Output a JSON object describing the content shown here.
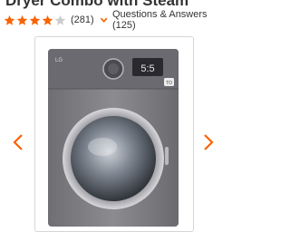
{
  "product": {
    "title": "Dryer Combo with Steam",
    "rating_fraction": 0.8,
    "review_count": "(281)",
    "qa_label": "Questions & Answers (125)"
  },
  "colors": {
    "star": "#f96302",
    "star_empty": "#cccccc",
    "chevron": "#f96302",
    "arrow": "#f96302",
    "washer_body": "#7b7b80",
    "washer_panel": "#5f5f64"
  },
  "washer": {
    "brand": "LG",
    "display": "5:5",
    "badge": "TO"
  }
}
